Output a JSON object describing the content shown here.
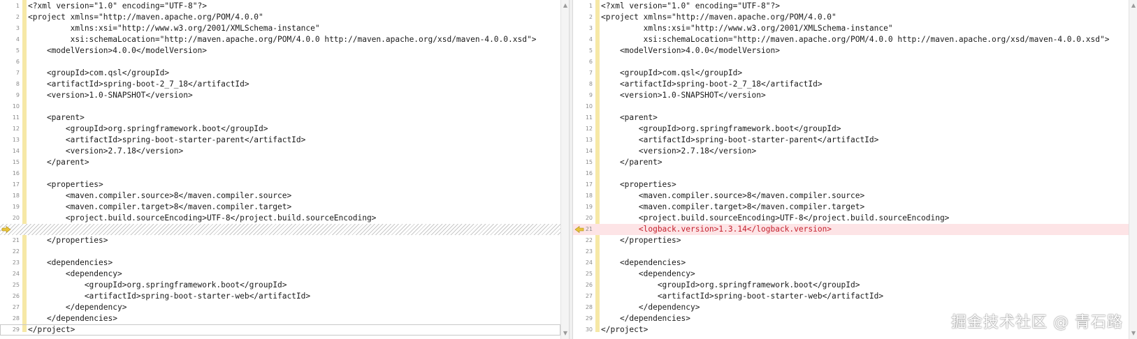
{
  "left_pane": {
    "lines": [
      {
        "n": "1",
        "text": "<?xml version=\"1.0\" encoding=\"UTF-8\"?>"
      },
      {
        "n": "2",
        "text": "<project xmlns=\"http://maven.apache.org/POM/4.0.0\""
      },
      {
        "n": "3",
        "text": "         xmlns:xsi=\"http://www.w3.org/2001/XMLSchema-instance\""
      },
      {
        "n": "4",
        "text": "         xsi:schemaLocation=\"http://maven.apache.org/POM/4.0.0 http://maven.apache.org/xsd/maven-4.0.0.xsd\">"
      },
      {
        "n": "5",
        "text": "    <modelVersion>4.0.0</modelVersion>"
      },
      {
        "n": "6",
        "text": ""
      },
      {
        "n": "7",
        "text": "    <groupId>com.qsl</groupId>"
      },
      {
        "n": "8",
        "text": "    <artifactId>spring-boot-2_7_18</artifactId>"
      },
      {
        "n": "9",
        "text": "    <version>1.0-SNAPSHOT</version>"
      },
      {
        "n": "10",
        "text": ""
      },
      {
        "n": "11",
        "text": "    <parent>"
      },
      {
        "n": "12",
        "text": "        <groupId>org.springframework.boot</groupId>"
      },
      {
        "n": "13",
        "text": "        <artifactId>spring-boot-starter-parent</artifactId>"
      },
      {
        "n": "14",
        "text": "        <version>2.7.18</version>"
      },
      {
        "n": "15",
        "text": "    </parent>"
      },
      {
        "n": "16",
        "text": ""
      },
      {
        "n": "17",
        "text": "    <properties>"
      },
      {
        "n": "18",
        "text": "        <maven.compiler.source>8</maven.compiler.source>"
      },
      {
        "n": "19",
        "text": "        <maven.compiler.target>8</maven.compiler.target>"
      },
      {
        "n": "20",
        "text": "        <project.build.sourceEncoding>UTF-8</project.build.sourceEncoding>"
      },
      {
        "n": "",
        "text": "",
        "kind": "filler"
      },
      {
        "n": "21",
        "text": "    </properties>"
      },
      {
        "n": "22",
        "text": ""
      },
      {
        "n": "23",
        "text": "    <dependencies>"
      },
      {
        "n": "24",
        "text": "        <dependency>"
      },
      {
        "n": "25",
        "text": "            <groupId>org.springframework.boot</groupId>"
      },
      {
        "n": "26",
        "text": "            <artifactId>spring-boot-starter-web</artifactId>"
      },
      {
        "n": "27",
        "text": "        </dependency>"
      },
      {
        "n": "28",
        "text": "    </dependencies>"
      },
      {
        "n": "29",
        "text": "</project>",
        "kind": "current"
      }
    ]
  },
  "right_pane": {
    "lines": [
      {
        "n": "1",
        "text": "<?xml version=\"1.0\" encoding=\"UTF-8\"?>"
      },
      {
        "n": "2",
        "text": "<project xmlns=\"http://maven.apache.org/POM/4.0.0\""
      },
      {
        "n": "3",
        "text": "         xmlns:xsi=\"http://www.w3.org/2001/XMLSchema-instance\""
      },
      {
        "n": "4",
        "text": "         xsi:schemaLocation=\"http://maven.apache.org/POM/4.0.0 http://maven.apache.org/xsd/maven-4.0.0.xsd\">"
      },
      {
        "n": "5",
        "text": "    <modelVersion>4.0.0</modelVersion>"
      },
      {
        "n": "6",
        "text": ""
      },
      {
        "n": "7",
        "text": "    <groupId>com.qsl</groupId>"
      },
      {
        "n": "8",
        "text": "    <artifactId>spring-boot-2_7_18</artifactId>"
      },
      {
        "n": "9",
        "text": "    <version>1.0-SNAPSHOT</version>"
      },
      {
        "n": "10",
        "text": ""
      },
      {
        "n": "11",
        "text": "    <parent>"
      },
      {
        "n": "12",
        "text": "        <groupId>org.springframework.boot</groupId>"
      },
      {
        "n": "13",
        "text": "        <artifactId>spring-boot-starter-parent</artifactId>"
      },
      {
        "n": "14",
        "text": "        <version>2.7.18</version>"
      },
      {
        "n": "15",
        "text": "    </parent>"
      },
      {
        "n": "16",
        "text": ""
      },
      {
        "n": "17",
        "text": "    <properties>"
      },
      {
        "n": "18",
        "text": "        <maven.compiler.source>8</maven.compiler.source>"
      },
      {
        "n": "19",
        "text": "        <maven.compiler.target>8</maven.compiler.target>"
      },
      {
        "n": "20",
        "text": "        <project.build.sourceEncoding>UTF-8</project.build.sourceEncoding>"
      },
      {
        "n": "21",
        "text": "        <logback.version>1.3.14</logback.version>",
        "kind": "added"
      },
      {
        "n": "22",
        "text": "    </properties>"
      },
      {
        "n": "23",
        "text": ""
      },
      {
        "n": "24",
        "text": "    <dependencies>"
      },
      {
        "n": "25",
        "text": "        <dependency>"
      },
      {
        "n": "26",
        "text": "            <groupId>org.springframework.boot</groupId>"
      },
      {
        "n": "27",
        "text": "            <artifactId>spring-boot-starter-web</artifactId>"
      },
      {
        "n": "28",
        "text": "        </dependency>"
      },
      {
        "n": "29",
        "text": "    </dependencies>"
      },
      {
        "n": "30",
        "text": "</project>"
      }
    ]
  },
  "diff_marker_icon": "arrow-right-icon",
  "scroll_up_icon": "chevron-up-icon",
  "scroll_down_icon": "chevron-down-icon",
  "colors": {
    "change_strip": "#f6e8a6",
    "added_bg": "#fde4e6",
    "added_text": "#c4202d",
    "marker": "#e8c33a"
  },
  "watermark": "掘金技术社区 @ 青石路"
}
